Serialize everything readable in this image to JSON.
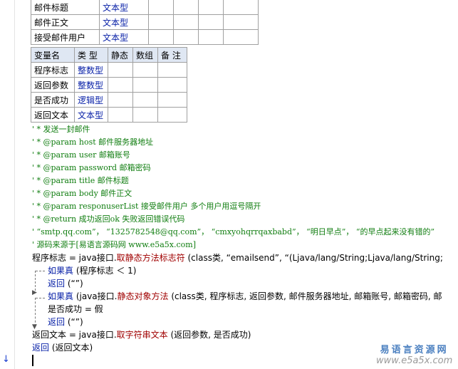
{
  "table1": {
    "rows": [
      {
        "name": "邮件标题",
        "type": "文本型"
      },
      {
        "name": "邮件正文",
        "type": "文本型"
      },
      {
        "name": "接受邮件用户",
        "type": "文本型"
      }
    ]
  },
  "table2": {
    "headers": [
      "变量名",
      "类 型",
      "静态",
      "数组",
      "备 注"
    ],
    "rows": [
      {
        "name": "程序标志",
        "type": "整数型"
      },
      {
        "name": "返回参数",
        "type": "整数型"
      },
      {
        "name": "是否成功",
        "type": "逻辑型"
      },
      {
        "name": "返回文本",
        "type": "文本型"
      }
    ]
  },
  "code": {
    "c1": "' * 发送一封邮件",
    "c2": "' * @param host  邮件服务器地址",
    "c3": "' * @param user  邮箱账号",
    "c4": "' * @param password 邮箱密码",
    "c5": "' * @param title 邮件标题",
    "c6": "' * @param body 邮件正文",
    "c7": "' * @param responuserList 接受邮件用户 多个用户用逗号隔开",
    "c8": "' * @return 成功返回ok 失败返回错误代码",
    "c9": "' “smtp.qq.com”， “1325782548@qq.com”， “cmxyohqrrqaxbabd”， “明日早点”， “的早点起来没有错的”",
    "c10": "' 源码来源于[易语言源码网 www.e5a5x.com]",
    "l11a": "程序标志 = java接口.",
    "l11b": "取静态方法标志符",
    "l11c": " (class类, “emailsend”, “(Ljava/lang/String;Ljava/lang/String;",
    "l12a": "如果真",
    "l12b": " (程序标志 ＜ 1)",
    "l13a": "返回",
    "l13b": " (“”)",
    "l14a": "如果真",
    "l14b": " (java接口.",
    "l14c": "静态对象方法",
    "l14d": " (class类, 程序标志, 返回参数, 邮件服务器地址, 邮箱账号, 邮箱密码, 邮",
    "l15": "是否成功 = 假",
    "l16a": "返回",
    "l16b": " (“”)",
    "l17a": "返回文本 = java接口.",
    "l17b": "取字符串文本",
    "l17c": " (返回参数, 是否成功)",
    "l18a": "返回",
    "l18b": " (返回文本)"
  },
  "watermark": {
    "line1": "易语言资源网",
    "line2": "www.e5a5x.com"
  },
  "colors": {
    "comment": "#0f7d0f",
    "keyword": "#0a22a8",
    "method": "#a00000",
    "header_bg": "#dfe7f3"
  }
}
